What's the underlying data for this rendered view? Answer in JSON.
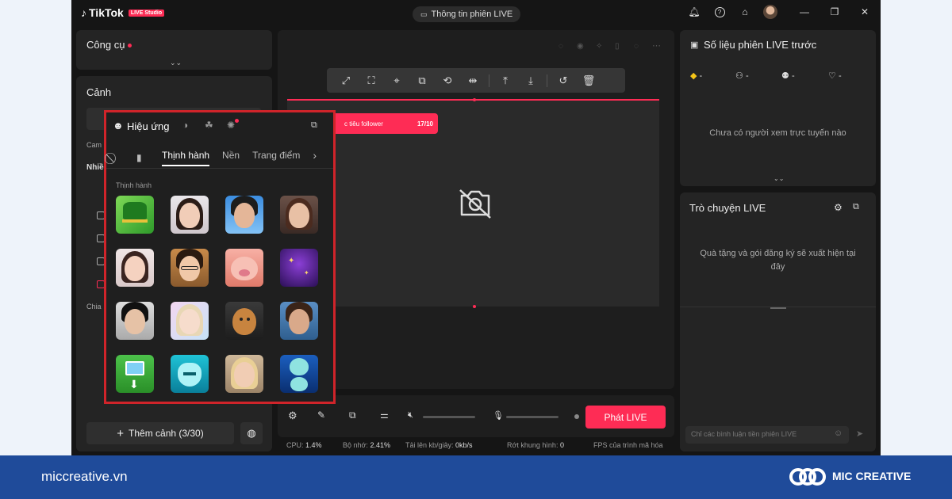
{
  "app": {
    "name": "TikTok",
    "badge": "LIVE Studio",
    "session_button": "Thông tin phiên LIVE"
  },
  "left": {
    "tools_title": "Công cụ",
    "scene_title": "Cảnh",
    "truncated_labels": [
      "Cam",
      "Nhiề",
      "Chia"
    ],
    "add_scene": "Thêm cảnh (3/30)"
  },
  "effects": {
    "title": "Hiệu ứng",
    "tabs": [
      "Thịnh hành",
      "Nền",
      "Trang điểm"
    ],
    "section": "Thịnh hành",
    "items": [
      {
        "name": "green-hat-effect"
      },
      {
        "name": "woman-portrait-effect"
      },
      {
        "name": "blue-sky-man-effect"
      },
      {
        "name": "woman-portrait-effect"
      },
      {
        "name": "girl-portrait-effect"
      },
      {
        "name": "glasses-man-effect"
      },
      {
        "name": "pig-face-effect"
      },
      {
        "name": "purple-sparkle-effect"
      },
      {
        "name": "man-portrait-effect"
      },
      {
        "name": "blonde-glow-effect"
      },
      {
        "name": "gingerbread-effect"
      },
      {
        "name": "man-portrait-effect"
      },
      {
        "name": "image-download-effect"
      },
      {
        "name": "cyan-mask-effect"
      },
      {
        "name": "blonde-woman-effect"
      },
      {
        "name": "alien-face-effect"
      }
    ]
  },
  "preview": {
    "goal_text": "c tiêu follower",
    "goal_count": "17/10"
  },
  "controls": {
    "go_live": "Phát LIVE",
    "stats": [
      {
        "label": "CPU:",
        "value": "1.4%"
      },
      {
        "label": "Bộ nhớ:",
        "value": "2.41%"
      },
      {
        "label": "Tải lên kb/giây:",
        "value": "0kb/s"
      },
      {
        "label": "Rớt khung hình:",
        "value": "0"
      },
      {
        "label": "FPS của trình mã hóa",
        "value": ""
      }
    ]
  },
  "right": {
    "stats_title": "Số liệu phiên LIVE trước",
    "metrics": [
      "-",
      "-",
      "-",
      "-"
    ],
    "empty_viewers": "Chưa có người xem trực tuyến nào",
    "chat_title": "Trò chuyện LIVE",
    "chat_empty": "Quà tặng và gói đăng ký sẽ xuất hiện tại đây",
    "chat_placeholder": "Chỉ các bình luận tiền phiên LIVE"
  },
  "footer": {
    "url": "miccreative.vn",
    "brand": "MIC CREATIVE"
  },
  "colors": {
    "accent": "#fe2c55",
    "highlight_border": "#d0242a",
    "footer_bg": "#1f4b9a"
  }
}
